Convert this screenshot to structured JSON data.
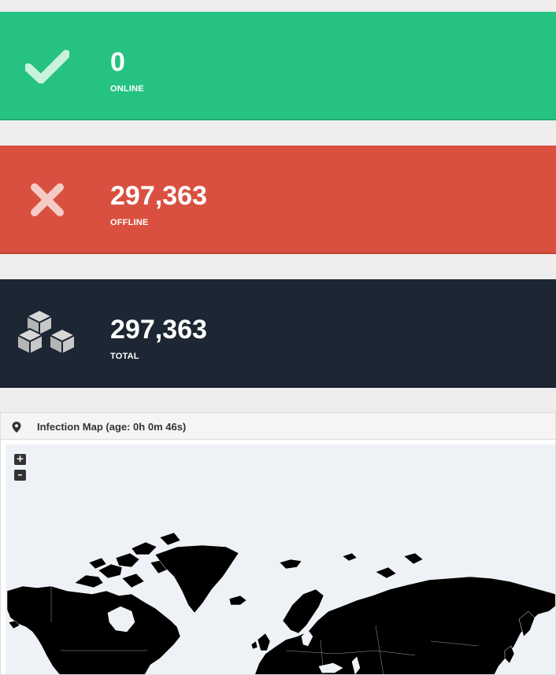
{
  "stats": {
    "online": {
      "value": "0",
      "label": "ONLINE",
      "color": "#26c281",
      "icon": "check-icon"
    },
    "offline": {
      "value": "297,363",
      "label": "OFFLINE",
      "color": "#d95040",
      "icon": "cross-icon"
    },
    "total": {
      "value": "297,363",
      "label": "TOTAL",
      "color": "#1c2733",
      "icon": "cubes-icon"
    }
  },
  "map": {
    "title": "Infection Map (age: 0h 0m 46s)",
    "zoom_in_label": "+",
    "zoom_out_label": "–",
    "land_color": "#000000",
    "water_color": "#eef2f6",
    "icon": "map-marker-icon"
  }
}
